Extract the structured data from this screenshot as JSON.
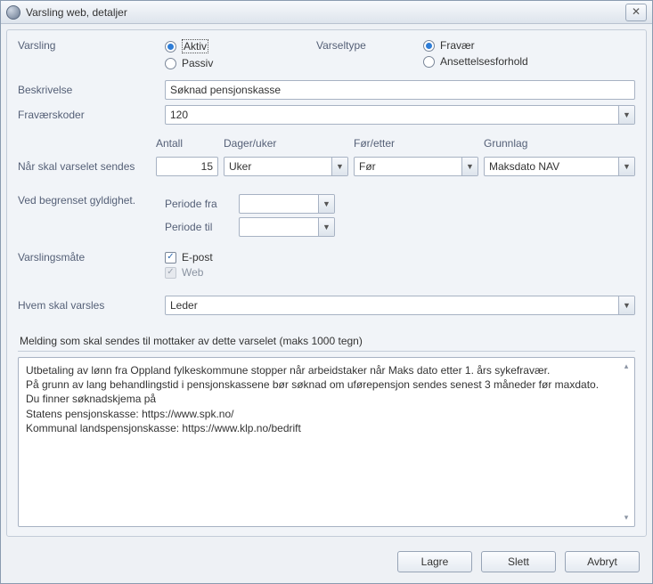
{
  "window": {
    "title": "Varsling web, detaljer"
  },
  "labels": {
    "varsling": "Varsling",
    "varseltype": "Varseltype",
    "beskrivelse": "Beskrivelse",
    "fravaerskoder": "Fraværskoder",
    "naar": "Når skal varselet sendes",
    "antall": "Antall",
    "dager_uker": "Dager/uker",
    "foer_etter": "Før/etter",
    "grunnlag": "Grunnlag",
    "ved_begrenset": "Ved begrenset gyldighet.",
    "periode_fra": "Periode fra",
    "periode_til": "Periode til",
    "varslingsmaate": "Varslingsmåte",
    "hvem": "Hvem skal varsles",
    "melding_head": "Melding som skal sendes til mottaker av dette varselet (maks 1000 tegn)"
  },
  "radios": {
    "aktiv": "Aktiv",
    "passiv": "Passiv",
    "fravaer": "Fravær",
    "ansettelse": "Ansettelsesforhold"
  },
  "values": {
    "beskrivelse": "Søknad pensjonskasse",
    "fravaerskoder": "120",
    "antall": "15",
    "dager_uker": "Uker",
    "foer_etter": "Før",
    "grunnlag": "Maksdato NAV",
    "periode_fra": "",
    "periode_til": "",
    "hvem": "Leder"
  },
  "checkboxes": {
    "epost": "E-post",
    "web": "Web"
  },
  "message": "Utbetaling av lønn fra Oppland fylkeskommune stopper når arbeidstaker når Maks dato etter 1. års sykefravær.\nPå grunn av lang behandlingstid i pensjonskassene bør søknad om uførepensjon sendes senest 3 måneder før maxdato.\nDu finner søknadskjema på\nStatens pensjonskasse: https://www.spk.no/\nKommunal landspensjonskasse: https://www.klp.no/bedrift",
  "buttons": {
    "lagre": "Lagre",
    "slett": "Slett",
    "avbryt": "Avbryt"
  }
}
